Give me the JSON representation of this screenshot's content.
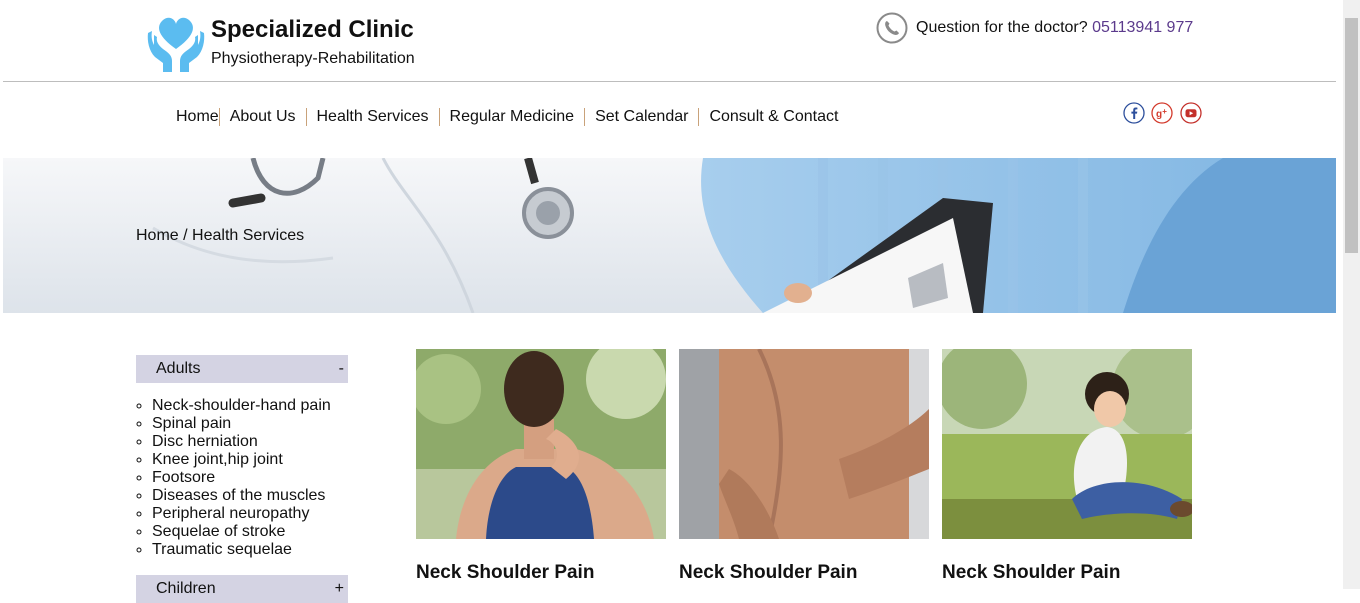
{
  "header": {
    "title": "Specialized Clinic",
    "subtitle": "Physiotherapy-Rehabilitation",
    "question_label": "Question for the doctor?",
    "phone": "05113941 977",
    "brand_color": "#5bbcf0"
  },
  "nav": {
    "items": [
      {
        "label": "Home"
      },
      {
        "label": "About Us"
      },
      {
        "label": "Health Services"
      },
      {
        "label": "Regular Medicine"
      },
      {
        "label": "Set Calendar"
      },
      {
        "label": "Consult & Contact"
      }
    ]
  },
  "social": [
    {
      "icon": "facebook-icon",
      "glyph": "f",
      "color": "#2d4f9c"
    },
    {
      "icon": "google-plus-icon",
      "glyph": "g+",
      "color": "#d33a2c"
    },
    {
      "icon": "youtube-icon",
      "glyph": "▶",
      "color": "#c4302b"
    }
  ],
  "breadcrumb": {
    "home": "Home",
    "separator": "/",
    "current": "Health Services"
  },
  "sidebar": {
    "categories": [
      {
        "label": "Adults",
        "toggle": "-",
        "items": [
          "Neck-shoulder-hand pain",
          "Spinal pain",
          "Disc herniation",
          "Knee joint,hip joint",
          "Footsore",
          "Diseases of the muscles",
          "Peripheral neuropathy",
          "Sequelae of stroke",
          "Traumatic sequelae"
        ]
      },
      {
        "label": "Children",
        "toggle": "+"
      }
    ]
  },
  "cards": [
    {
      "title": "Neck Shoulder Pain",
      "image": "woman-neck-pain-photo"
    },
    {
      "title": "Neck Shoulder Pain",
      "image": "man-back-pain-photo"
    },
    {
      "title": "Neck Shoulder Pain",
      "image": "child-in-grass-photo"
    }
  ]
}
